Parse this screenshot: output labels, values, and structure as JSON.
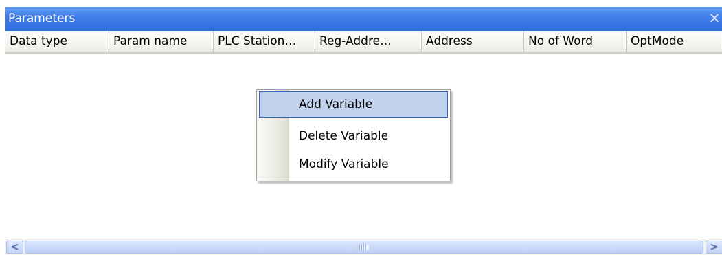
{
  "panel": {
    "title": "Parameters",
    "close_glyph": "×"
  },
  "table": {
    "columns": [
      "Data type",
      "Param name",
      "PLC Station…",
      "Reg-Addre…",
      "Address",
      "No of Word",
      "OptMode"
    ],
    "rows": []
  },
  "context_menu": {
    "items": [
      {
        "label": "Add Variable",
        "highlighted": true
      },
      {
        "label": "Delete Variable",
        "highlighted": false
      },
      {
        "label": "Modify Variable",
        "highlighted": false
      }
    ]
  },
  "scrollbar": {
    "left_arrow": "<",
    "right_arrow": ">"
  },
  "icons": {
    "close": "close-icon",
    "scroll_left": "chevron-left-icon",
    "scroll_right": "chevron-right-icon",
    "grip": "scroll-grip-icon"
  },
  "colors": {
    "titlebar": "#3f7de8",
    "menu_highlight": "#c1d2ee",
    "menu_highlight_border": "#316ac5"
  }
}
